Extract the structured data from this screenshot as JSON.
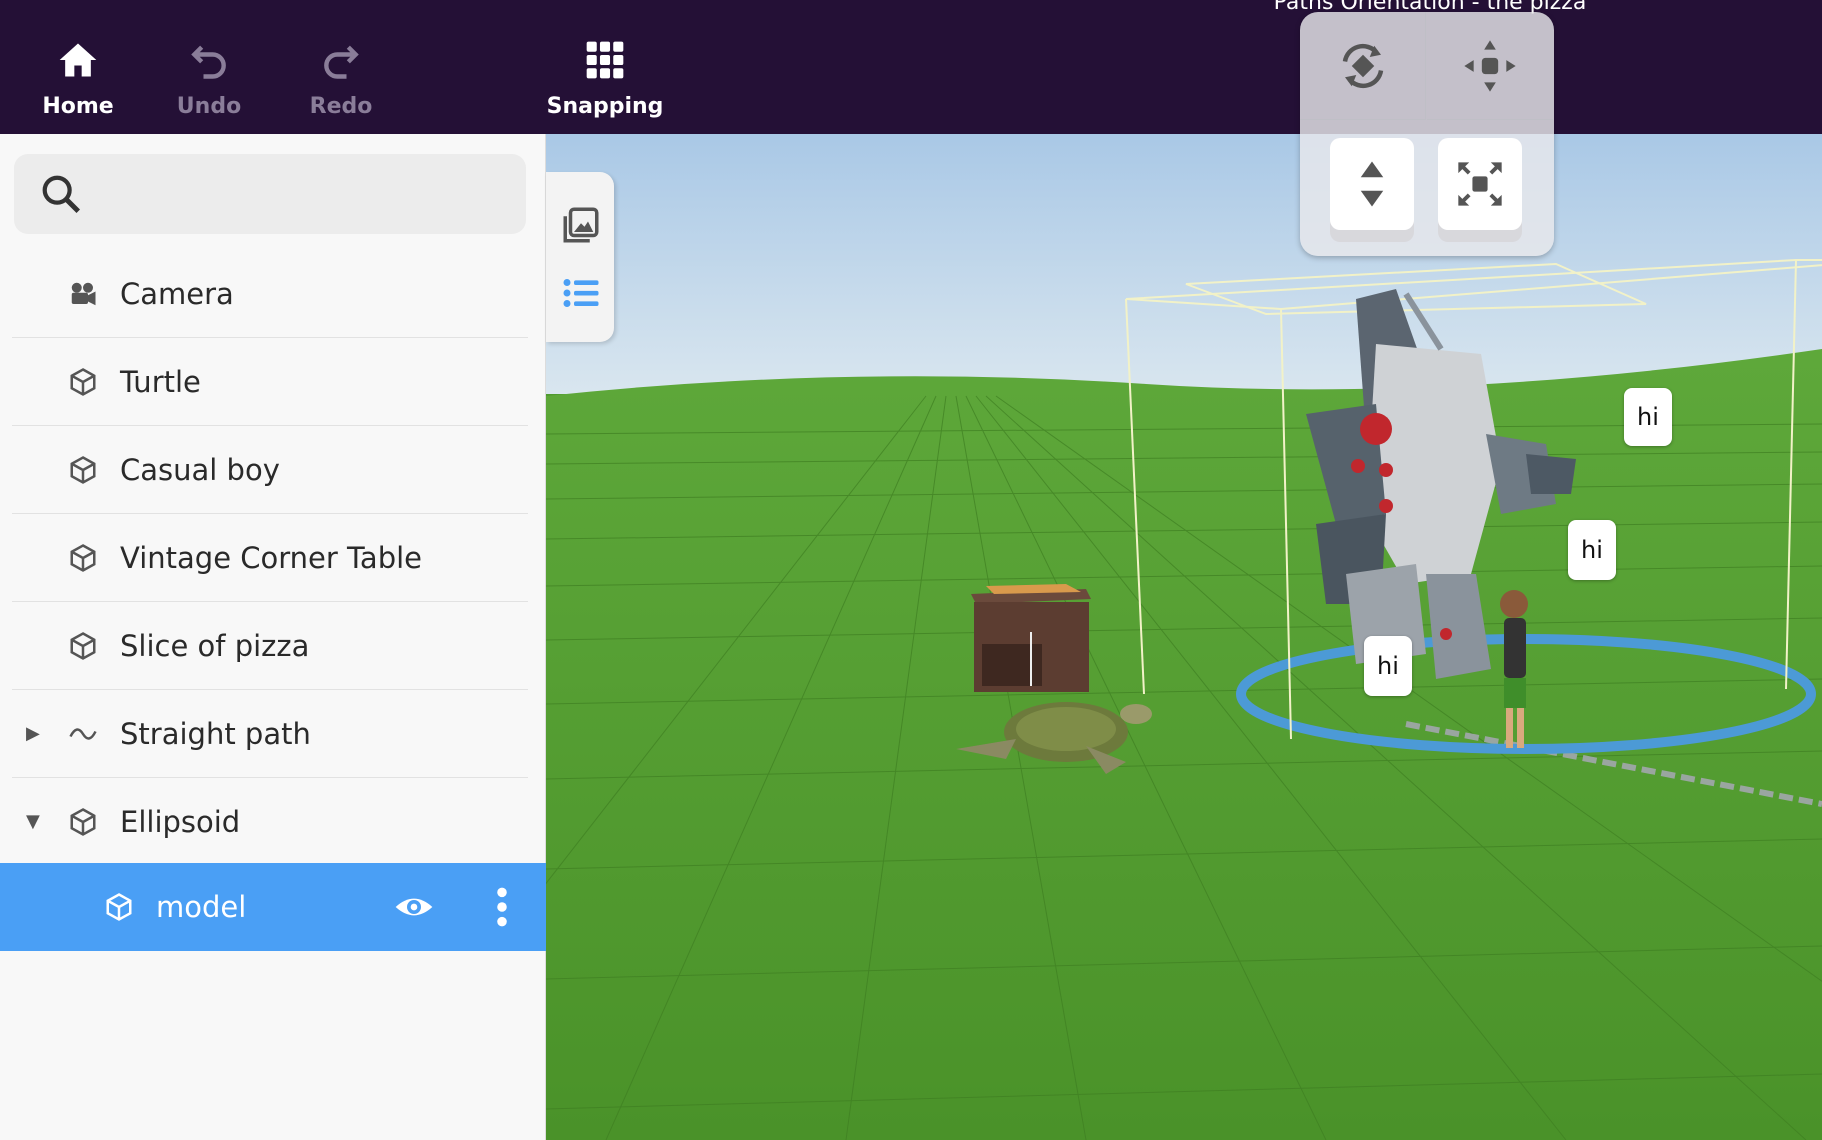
{
  "toolbar": {
    "home_label": "Home",
    "undo_label": "Undo",
    "redo_label": "Redo",
    "snapping_label": "Snapping"
  },
  "scene": {
    "title": "Paths Orientation - the pizza",
    "speech_bubbles": [
      "hi",
      "hi",
      "hi"
    ]
  },
  "search": {
    "placeholder": "",
    "value": ""
  },
  "sidebar": {
    "items": [
      {
        "label": "Camera",
        "icon": "camera-icon"
      },
      {
        "label": "Turtle",
        "icon": "cube-icon"
      },
      {
        "label": "Casual boy",
        "icon": "cube-icon"
      },
      {
        "label": "Vintage Corner Table",
        "icon": "cube-icon"
      },
      {
        "label": "Slice of pizza",
        "icon": "cube-icon"
      },
      {
        "label": "Straight path",
        "icon": "path-icon",
        "expandable": true,
        "expanded": false
      },
      {
        "label": "Ellipsoid",
        "icon": "cube-icon",
        "expandable": true,
        "expanded": true
      }
    ],
    "selected_child": {
      "label": "model",
      "icon": "cube-icon",
      "visible": true
    }
  },
  "side_tabs": [
    "gallery-icon",
    "list-icon"
  ],
  "gizmo": {
    "tools": [
      "rotate-icon",
      "move-icon",
      "up-down-icon",
      "resize-icon"
    ]
  },
  "colors": {
    "topbar": "#241036",
    "accent": "#4a9ff5",
    "ground": "#4f9a2f",
    "sky": "#b9d3ea"
  }
}
